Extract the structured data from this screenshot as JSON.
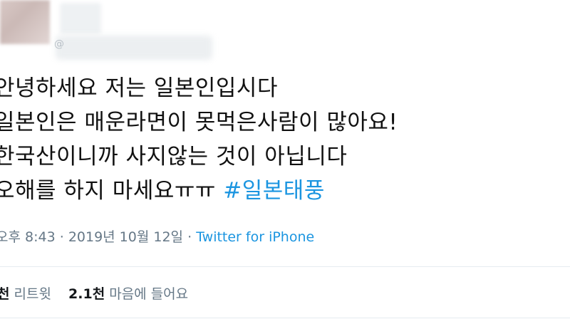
{
  "tweet": {
    "lines": [
      "안녕하세요 저는 일본인입시다",
      "일본인은 매운라면이 못먹은사람이 많아요!",
      "한국산이니까 사지않는 것이 아닙니다",
      "오해를 하지 마세요ㅠㅠ"
    ],
    "hashtag": "#일본태풍"
  },
  "meta": {
    "time": "오후 8:43",
    "date": "2019년 10월 12일",
    "separator": "·",
    "source": "Twitter for iPhone"
  },
  "stats": {
    "retweets_count": "천",
    "retweets_label": "리트윗",
    "likes_count": "2.1천",
    "likes_label": "마음에 들어요"
  },
  "handle_prefix": "@"
}
